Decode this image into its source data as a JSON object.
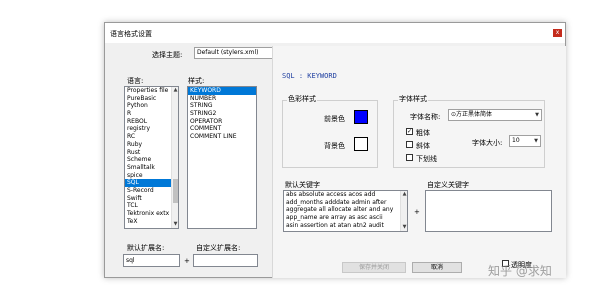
{
  "window": {
    "title": "语言格式设置",
    "close_label": "x"
  },
  "theme": {
    "label": "选择主题:",
    "value": "Default (stylers.xml)"
  },
  "languages": {
    "label": "语言:",
    "items": [
      "Properties file",
      "PureBasic",
      "Python",
      "R",
      "REBOL",
      "registry",
      "RC",
      "Ruby",
      "Rust",
      "Scheme",
      "Smalltalk",
      "spice",
      "SQL",
      "S-Record",
      "Swift",
      "TCL",
      "Tektronix extx",
      "TeX"
    ],
    "selected": "SQL"
  },
  "styles": {
    "label": "样式:",
    "items": [
      "KEYWORD",
      "NUMBER",
      "STRING",
      "STRING2",
      "OPERATOR",
      "COMMENT",
      "COMMENT LINE"
    ],
    "selected": "KEYWORD"
  },
  "header": {
    "text": "SQL : KEYWORD"
  },
  "color_style": {
    "label": "色彩样式",
    "fg_label": "前景色",
    "bg_label": "背景色",
    "fg_color": "#0000ff",
    "bg_color": "#ffffff"
  },
  "font_style": {
    "label": "字体样式",
    "name_label": "字体名称:",
    "name_value": "⊙方正黑体简体",
    "bold_label": "粗体",
    "bold_checked": true,
    "italic_label": "斜体",
    "underline_label": "下划线",
    "size_label": "字体大小:",
    "size_value": "10"
  },
  "default_keywords": {
    "label": "默认关键字",
    "lines": [
      "abs absolute access acos add",
      "add_months adddate admin after",
      "aggregate all allocate alter and any",
      "app_name are array as asc ascii",
      "asin assertion at atan atn2 audit"
    ]
  },
  "custom_keywords": {
    "label": "自定义关键字",
    "plus": "+"
  },
  "default_ext": {
    "label": "默认扩展名:",
    "value": "sql",
    "plus": "+"
  },
  "custom_ext": {
    "label": "自定义扩展名:",
    "value": ""
  },
  "buttons": {
    "save_close": "保存并关闭",
    "cancel": "取消",
    "transparency": "透明度"
  },
  "watermark": {
    "text": "知乎 @求知"
  }
}
